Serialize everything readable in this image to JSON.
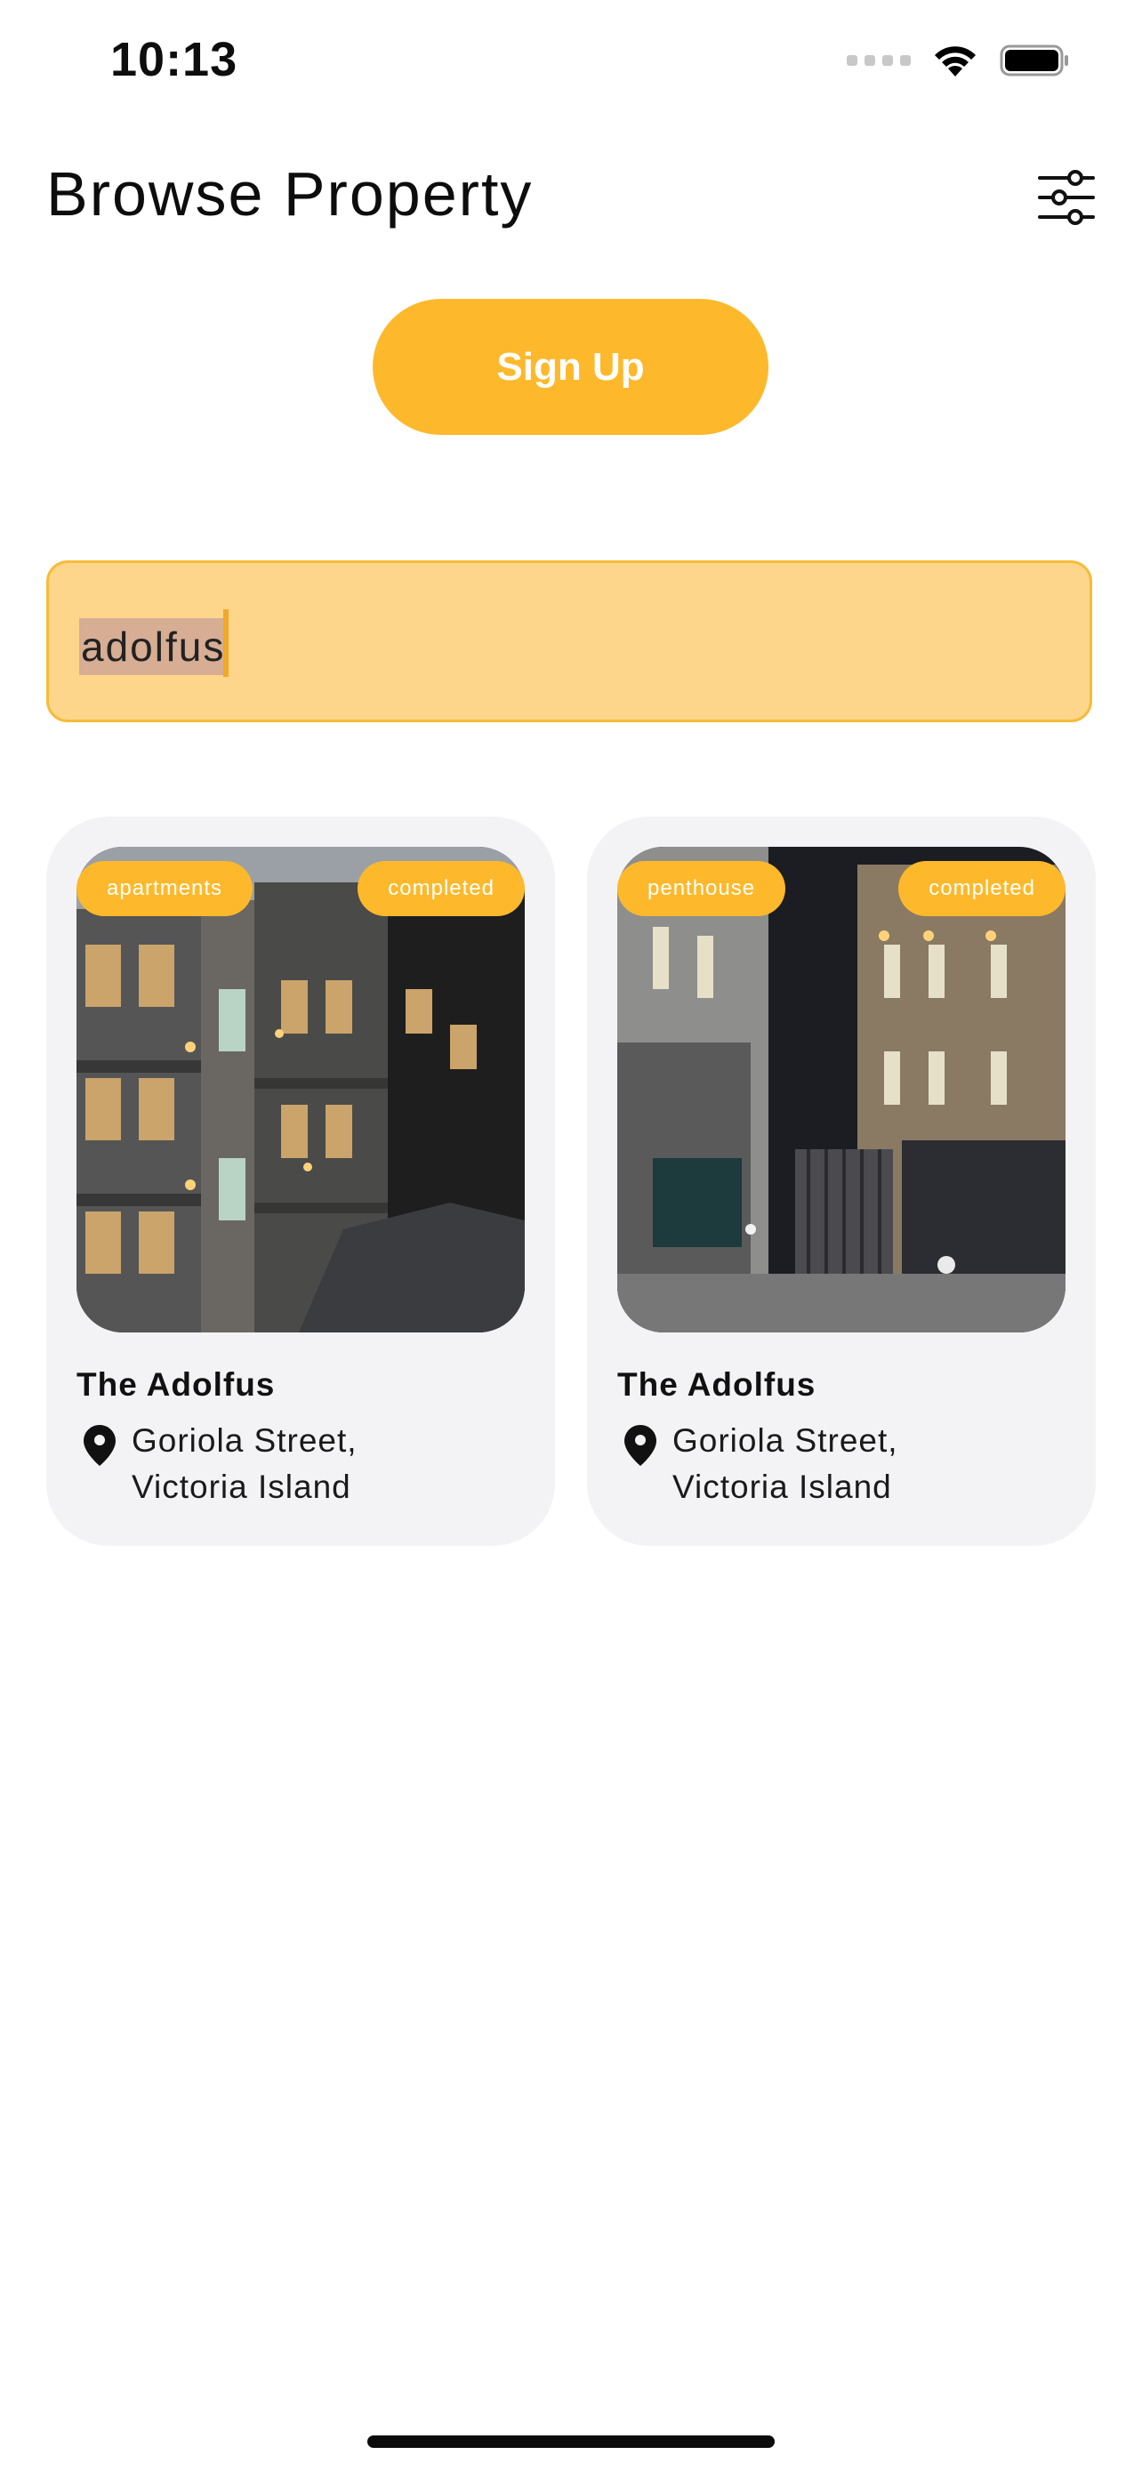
{
  "status_bar": {
    "time": "10:13",
    "icons": [
      "signal-dots-icon",
      "wifi-icon",
      "battery-icon"
    ]
  },
  "header": {
    "title": "Browse Property",
    "filter_icon": "sliders-icon"
  },
  "signup": {
    "label": "Sign Up"
  },
  "search": {
    "value": "adolfus"
  },
  "colors": {
    "accent": "#fdb92b",
    "search_bg": "#fdd68b",
    "card_bg": "#f3f3f6"
  },
  "properties": [
    {
      "category": "apartments",
      "status": "completed",
      "name": "The Adolfus",
      "address_line1": "Goriola Street,",
      "address_line2": "Victoria Island"
    },
    {
      "category": "penthouse",
      "status": "completed",
      "name": "The Adolfus",
      "address_line1": "Goriola Street,",
      "address_line2": "Victoria Island"
    }
  ]
}
